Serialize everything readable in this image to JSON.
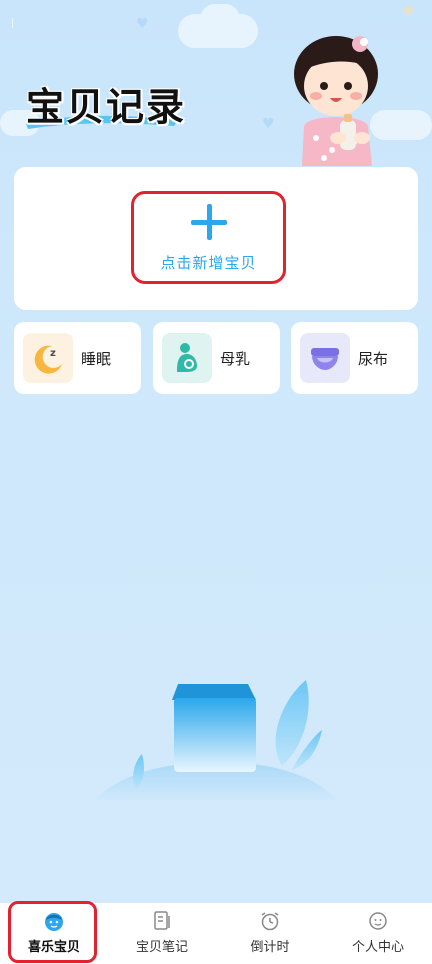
{
  "page": {
    "title": "宝贝记录"
  },
  "add_card": {
    "label": "点击新增宝贝"
  },
  "quick_actions": [
    {
      "label": "睡眠",
      "icon": "moon-icon"
    },
    {
      "label": "母乳",
      "icon": "breastfeeding-icon"
    },
    {
      "label": "尿布",
      "icon": "diaper-icon"
    }
  ],
  "bottom_nav": {
    "items": [
      {
        "label": "喜乐宝贝",
        "icon": "baby-face-icon",
        "active": true
      },
      {
        "label": "宝贝笔记",
        "icon": "notebook-icon",
        "active": false
      },
      {
        "label": "倒计时",
        "icon": "alarm-clock-icon",
        "active": false
      },
      {
        "label": "个人中心",
        "icon": "profile-face-icon",
        "active": false
      }
    ]
  },
  "colors": {
    "accent": "#2ba7ec",
    "highlight": "#e0232e",
    "background": "#cfe8fb"
  }
}
